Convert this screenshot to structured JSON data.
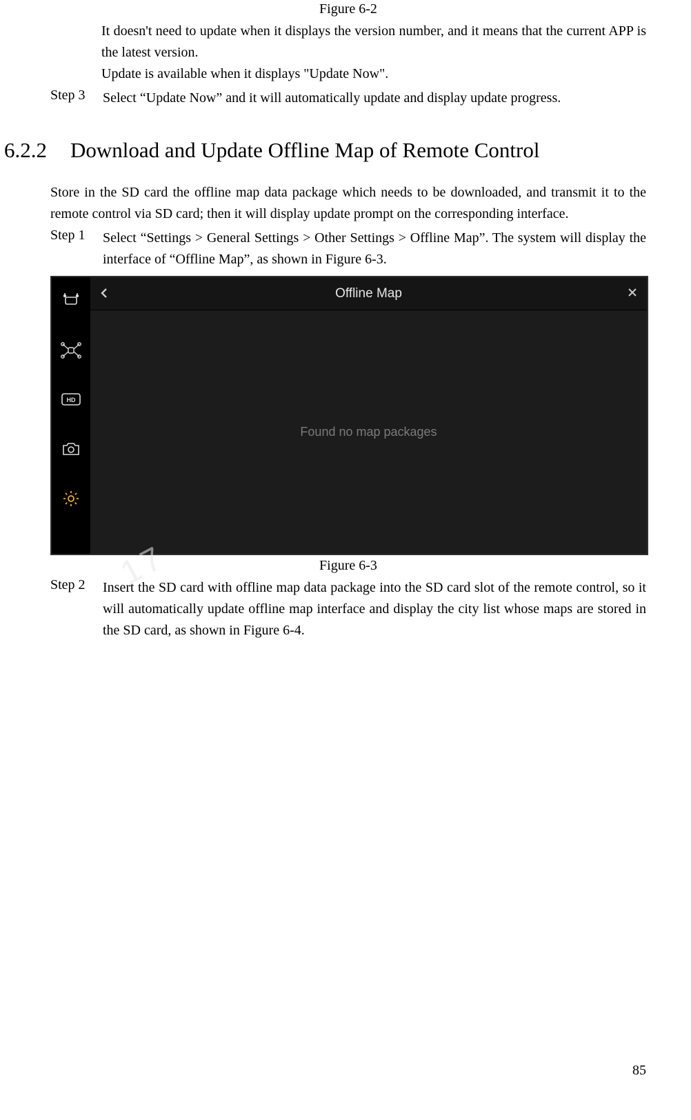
{
  "caption_top": "Figure 6-2",
  "notes": {
    "line1": "It doesn't need to update when it displays the version number, and it means that the current APP is the latest version.",
    "line2": "Update is available when it displays \"Update Now\"."
  },
  "top_step": {
    "label": "Step 3",
    "text": "Select “Update Now” and it will automatically update and display update progress."
  },
  "heading": {
    "number": "6.2.2",
    "title": "Download and Update Offline Map of Remote Control"
  },
  "intro": "Store in the SD card the offline map data package which needs to be downloaded, and transmit it to the remote control via SD card; then it will display update prompt on the corresponding interface.",
  "step1": {
    "label": "Step 1",
    "text": "Select “Settings > General Settings > Other Settings > Offline Map”. The system will display the interface of “Offline Map”, as shown in Figure 6-3."
  },
  "screenshot": {
    "title": "Offline Map",
    "empty_message": "Found no map packages",
    "sidebar_icons": [
      "remote-icon",
      "aircraft-icon",
      "hd-icon",
      "camera-icon",
      "gear-icon"
    ]
  },
  "caption_mid": "Figure 6-3",
  "step2": {
    "label": "Step 2",
    "text": "Insert the SD card with offline map data package into the SD card slot of the remote control, so it will automatically update offline map interface and display the city list whose maps are stored in the SD card, as shown in Figure 6-4."
  },
  "page_number": "85",
  "watermark": "17"
}
